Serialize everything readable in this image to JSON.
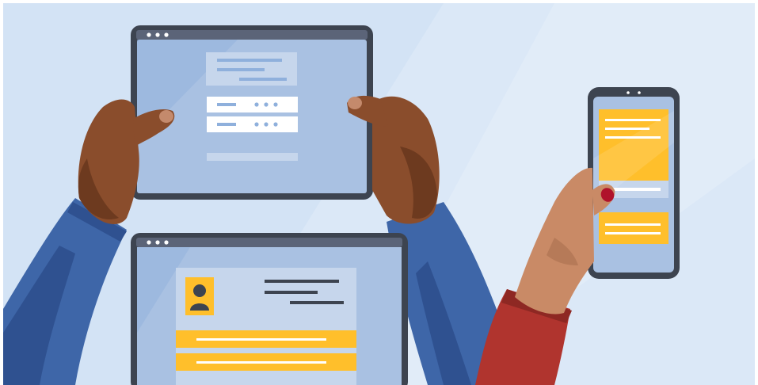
{
  "illustration": {
    "subject": "hands-holding-devices",
    "colors": {
      "background": "#d3e3f5",
      "background_light": "#e2ecf8",
      "device_frame": "#3d4450",
      "device_titlebar": "#5b6478",
      "screen": "#a9c1e2",
      "screen_dark": "#8fb0dc",
      "card_light": "#c6d6ec",
      "accent_yellow": "#ffbf2b",
      "accent_yellow_dark": "#f5ae12",
      "skin_dark": "#8a4d2c",
      "skin_dark_shade": "#6d3a1f",
      "skin_light": "#c98a66",
      "sleeve_blue": "#3e66a8",
      "sleeve_blue_dark": "#2f5190",
      "sleeve_red": "#b0342e",
      "sleeve_red_dark": "#8e2823",
      "nail_red": "#b0122b"
    },
    "devices": [
      {
        "type": "tablet",
        "content": "login-form"
      },
      {
        "type": "laptop",
        "content": "profile-page"
      },
      {
        "type": "smartphone",
        "content": "card-list"
      }
    ],
    "icons": [
      "user-avatar-icon",
      "window-dots-icon"
    ]
  }
}
